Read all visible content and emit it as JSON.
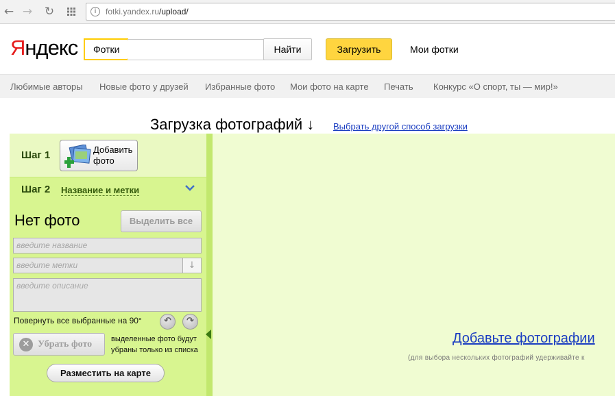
{
  "browser": {
    "url_host": "fotki.yandex.ru",
    "url_path": "/upload/",
    "back_icon": "arrow-left-icon",
    "forward_icon": "arrow-right-icon",
    "reload_icon": "reload-icon",
    "apps_icon": "apps-grid-icon",
    "site_icon": "site-info-icon"
  },
  "header": {
    "logo_first": "Я",
    "logo_rest": "ндекс",
    "search_tab": "Фотки",
    "search_button": "Найти",
    "upload_button": "Загрузить",
    "my_photos": "Мои фотки"
  },
  "subnav": {
    "items": [
      "Любимые авторы",
      "Новые фото у друзей",
      "Избранные фото",
      "Мои фото на карте",
      "Печать",
      "Конкурс «О спорт, ты — мир!»"
    ]
  },
  "page": {
    "title": "Загрузка фотографий ↓",
    "alt_method_link": "Выбрать другой способ загрузки"
  },
  "panel": {
    "step1_label": "Шаг 1",
    "add_photo_line1": "Добавить",
    "add_photo_line2": "фото",
    "step2_label": "Шаг 2",
    "step2_link": "Название и метки",
    "no_photo": "Нет фото",
    "select_all": "Выделить все",
    "name_placeholder": "введите название",
    "tags_placeholder": "введите метки",
    "description_placeholder": "введите описание",
    "rotate_label": "Повернуть все выбранные на 90°",
    "remove_photo": "Убрать фото",
    "remove_note_line1": "выделенные фото будут",
    "remove_note_line2": "убраны только из списка",
    "place_on_map": "Разместить на карте"
  },
  "drop": {
    "add_photos_link": "Добавьте фотографии",
    "hint": "(для выбора нескольких фотографий удерживайте к"
  },
  "colors": {
    "accent_yellow": "#ffd53f",
    "link_blue": "#1a3dc1",
    "panel_green": "#d8f590",
    "drop_green": "#f0fcd2",
    "logo_red": "#e51c1c"
  }
}
